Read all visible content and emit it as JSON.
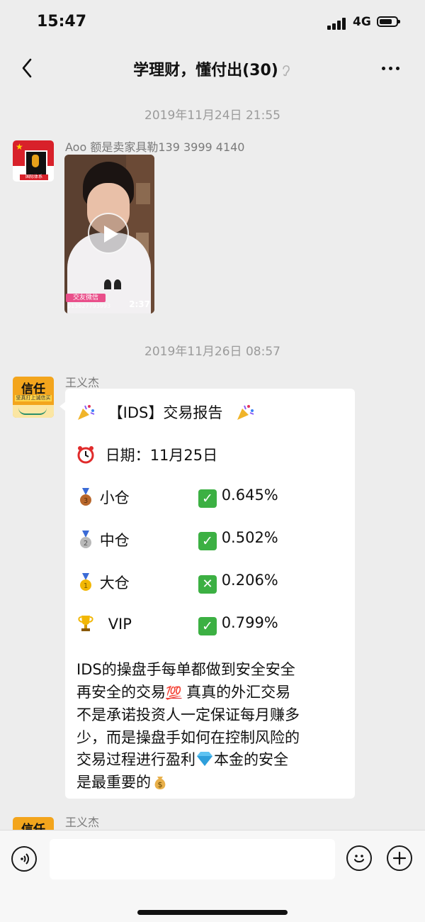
{
  "status_bar": {
    "time": "15:47",
    "network": "4G"
  },
  "header": {
    "title": "学理财，懂付出(30)"
  },
  "messages": [
    {
      "timestamp": "2019年11月24日 21:55",
      "sender": "Aoo 额是卖家具勒139 3999 4140",
      "avatar_label": "国际体系",
      "type": "video",
      "video": {
        "badge": "交友微信",
        "id": "p13627793993",
        "duration": "2:37"
      }
    },
    {
      "timestamp": "2019年11月26日 08:57",
      "sender": "王义杰",
      "avatar_text": "信任",
      "avatar_subtext": "坚真打上诚信买卖群",
      "type": "text",
      "report": {
        "title": "【IDS】交易报告",
        "date_label": "日期：",
        "date": "11月25日",
        "rows": [
          {
            "label": "小仓",
            "mark": "check",
            "value": "0.645%"
          },
          {
            "label": "中仓",
            "mark": "check",
            "value": "0.502%"
          },
          {
            "label": "大仓",
            "mark": "cross",
            "value": "0.206%"
          },
          {
            "label": "VIP",
            "mark": "check",
            "value": "0.799%"
          }
        ],
        "paragraph": [
          "IDS的操盘手每单都做到安全安全",
          "再安全的交易",
          "真真的外汇交易",
          "不是承诺投资人一定保证每月赚多",
          "少，而是操盘手如何在控制风险的",
          "交易过程进行盈利",
          "本金的安全",
          "是最重要的"
        ],
        "emoji_hundred": "💯"
      }
    },
    {
      "sender": "王义杰",
      "avatar_text": "信任"
    }
  ],
  "composer": {
    "value": "",
    "placeholder": ""
  },
  "colors": {
    "background": "#ededed",
    "bubble": "#ffffff",
    "check_green": "#3cb043",
    "timestamp": "#9b9b9b"
  }
}
